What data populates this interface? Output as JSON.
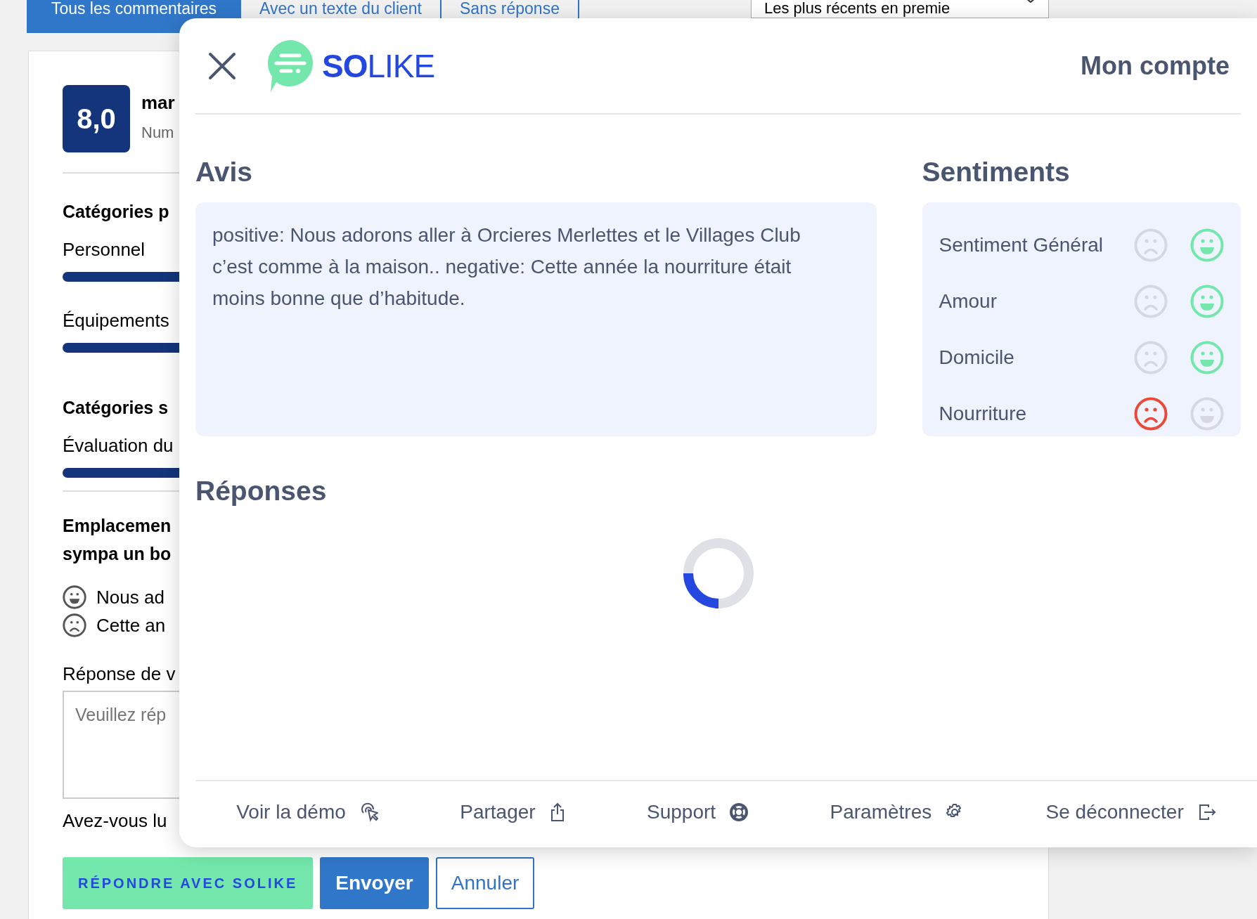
{
  "page": {
    "tabs": [
      {
        "label": "Tous les commentaires",
        "selected": true
      },
      {
        "label": "Avec un texte du client",
        "selected": false
      },
      {
        "label": "Sans réponse",
        "selected": false
      }
    ],
    "sort": {
      "value": "Les plus récents en premie"
    },
    "score": "8,0",
    "reviewer": "mar",
    "reviewer_meta": "Num",
    "sections": [
      {
        "title": "Catégories p",
        "items": [
          "Personnel",
          "Équipements"
        ]
      },
      {
        "title": "Catégories s",
        "items": [
          "Évaluation du"
        ]
      }
    ],
    "review_title": [
      "Emplacemen",
      "sympa un bo"
    ],
    "review_lines": [
      {
        "kind": "positive",
        "text": "Nous ad"
      },
      {
        "kind": "negative",
        "text": "Cette an"
      }
    ],
    "reply_label": "Réponse de v",
    "reply_placeholder": "Veuillez rép",
    "reply_hint": "Avez-vous lu",
    "buttons": [
      {
        "kind": "ai",
        "label": "RÉPONDRE AVEC SOLIKE"
      },
      {
        "kind": "primary",
        "label": "Envoyer"
      },
      {
        "kind": "outline",
        "label": "Annuler"
      }
    ]
  },
  "modal": {
    "logo": {
      "bold": "SO",
      "light": "LIKE"
    },
    "account": "Mon compte",
    "review_heading": "Avis",
    "review_text": "positive: Nous adorons aller à Orcieres Merlettes et le Villages Club c’est comme à la maison.. negative: Cette année la nourriture était moins bonne que d’habitude.",
    "sentiments_heading": "Sentiments",
    "sentiments": [
      {
        "label": "Sentiment Général",
        "positive": true
      },
      {
        "label": "Amour",
        "positive": true
      },
      {
        "label": "Domicile",
        "positive": true
      },
      {
        "label": "Nourriture",
        "positive": false
      }
    ],
    "responses_heading": "Réponses",
    "footer": [
      {
        "kind": "demo",
        "label": "Voir la démo"
      },
      {
        "kind": "share",
        "label": "Partager"
      },
      {
        "kind": "support",
        "label": "Support"
      },
      {
        "kind": "settings",
        "label": "Paramètres"
      },
      {
        "kind": "logout",
        "label": "Se déconnecter"
      }
    ]
  }
}
